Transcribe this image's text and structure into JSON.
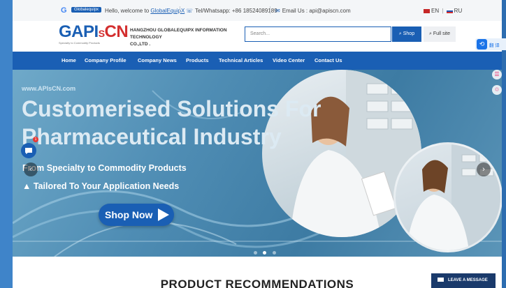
{
  "topbar": {
    "google_letter": "G",
    "badge": "Globalequipx",
    "welcome_prefix": "Hello, welcome to",
    "welcome_link": "GlobalEquipX",
    "phone": "Tel/Whatsapp: +86 18524089189",
    "email": "Email Us : api@apiscn.com",
    "lang_en": "EN",
    "lang_divider": "|",
    "lang_ru": "RU"
  },
  "header": {
    "logo_a": "GAPI",
    "logo_s": "S",
    "logo_b": "CN",
    "logo_tagline": "Specialty to Commodity Products",
    "company_line1": "HANGZHOU GLOBALEQUIPX INFORMATION TECHNOLOGY",
    "company_line2": "CO.,LTD .",
    "search_placeholder": "Search...",
    "shop_label": "Shop",
    "fullsite_label": "Full site"
  },
  "nav": {
    "items": [
      "Home",
      "Company Profile",
      "Company News",
      "Products",
      "Technical Articles",
      "Video Center",
      "Contact Us"
    ]
  },
  "hero": {
    "watermark": "www.APIsCN.com",
    "title_line1": "Customerised Solutions For",
    "title_line2": "Pharmaceutical Industry",
    "sub1": "From Specialty to Commodity Products",
    "sub2": "▲ Tailored To Your Application Needs",
    "shop_now": "Shop Now",
    "arrow_left": "‹",
    "arrow_right": "›"
  },
  "floating": {
    "translate_label": "翻 译",
    "chat_badge": "1",
    "side_icon1": "☰",
    "side_icon2": "♲"
  },
  "section": {
    "product_title": "PRODUCT RECOMMENDATIONS"
  },
  "leave_message": "LEAVE A MESSAGE",
  "colors": {
    "brand_blue": "#1a5fb4",
    "accent_red": "#d32f2f",
    "dark_navy": "#1a3a6b"
  },
  "icons": [
    "google-icon",
    "phone-icon",
    "email-icon",
    "search-icon",
    "chat-icon",
    "translate-icon",
    "arrow-left-icon",
    "arrow-right-icon",
    "play-icon",
    "mail-icon"
  ]
}
